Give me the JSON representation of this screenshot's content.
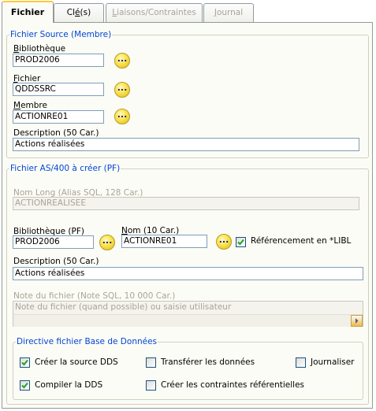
{
  "tabs": [
    {
      "label_pre": "",
      "label_u": "",
      "label_post": "Fichier"
    },
    {
      "label_pre": "Cl",
      "label_u": "é",
      "label_post": "(s)"
    },
    {
      "label_pre": "",
      "label_u": "L",
      "label_post": "iaisons/Contraintes"
    },
    {
      "label_pre": "",
      "label_u": "J",
      "label_post": "ournal"
    }
  ],
  "source": {
    "legend": "Fichier Source (Membre)",
    "library": {
      "label_pre": "",
      "label_u": "B",
      "label_post": "ibliothèque",
      "value": "PROD2006"
    },
    "file": {
      "label_pre": "",
      "label_u": "F",
      "label_post": "ichier",
      "value": "QDDSSRC"
    },
    "member": {
      "label_pre": "",
      "label_u": "M",
      "label_post": "embre",
      "value": "ACTIONRE01"
    },
    "description": {
      "label": "Description (50 Car.)",
      "value": "Actions réalisées"
    },
    "browse_label": "..."
  },
  "target": {
    "legend": "Fichier AS/400 à créer (PF)",
    "long_name": {
      "label": "Nom Long (Alias SQL, 128 Car.)",
      "value": "ACTIONREALISEE"
    },
    "library": {
      "label": "Bibliothèque (PF)",
      "value": "PROD2006"
    },
    "name": {
      "label_pre": "",
      "label_u": "N",
      "label_post": "om (10 Car.)",
      "value": "ACTIONRE01"
    },
    "referencing": {
      "label": "Référencement en *LIBL",
      "checked": true
    },
    "description": {
      "label": "Description (50 Car.)",
      "value": "Actions réalisées"
    },
    "note": {
      "label": "Note du fichier (Note SQL, 10 000 Car.)",
      "value": "Note du fichier (quand possible) ou saisie utilisateur"
    },
    "browse_label": "..."
  },
  "directive": {
    "legend": "Directive fichier Base de Données",
    "options": {
      "create_source": {
        "label": "Créer la source DDS",
        "checked": true
      },
      "transfer": {
        "label": "Transférer les données",
        "checked": false
      },
      "journal": {
        "label": "Journaliser",
        "checked": false
      },
      "compile": {
        "label": "Compiler la DDS",
        "checked": true
      },
      "constraints": {
        "label": "Créer les contraintes référentielles",
        "checked": false
      }
    }
  }
}
